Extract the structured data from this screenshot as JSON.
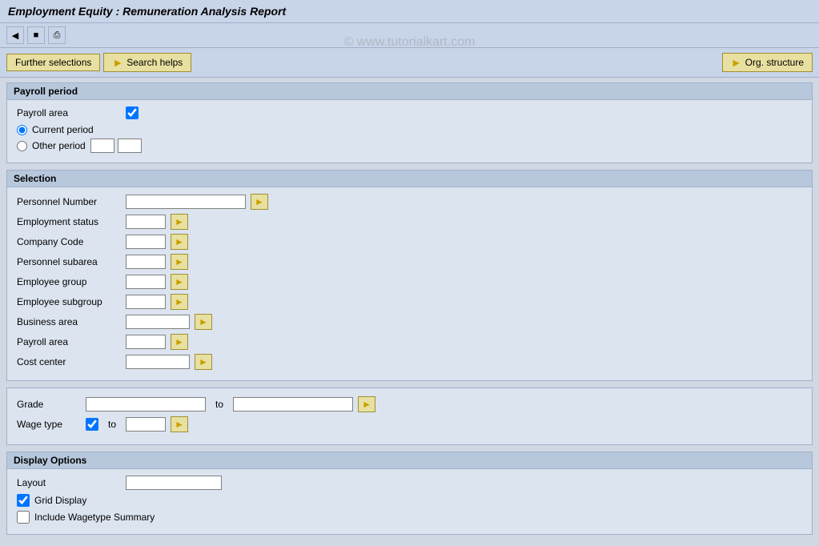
{
  "title": "Employment Equity : Remuneration Analysis Report",
  "watermark": "© www.tutorialkart.com",
  "toolbar": {
    "icons": [
      "back",
      "save",
      "print"
    ]
  },
  "buttons": {
    "further_selections": "Further selections",
    "search_helps": "Search helps",
    "org_structure": "Org. structure"
  },
  "payroll_period": {
    "header": "Payroll period",
    "payroll_area_label": "Payroll area",
    "current_period_label": "Current period",
    "other_period_label": "Other period"
  },
  "selection": {
    "header": "Selection",
    "fields": [
      {
        "label": "Personnel Number",
        "size": "lg"
      },
      {
        "label": "Employment status",
        "size": "sm"
      },
      {
        "label": "Company Code",
        "size": "sm"
      },
      {
        "label": "Personnel subarea",
        "size": "sm"
      },
      {
        "label": "Employee group",
        "size": "sm"
      },
      {
        "label": "Employee subgroup",
        "size": "sm"
      },
      {
        "label": "Business area",
        "size": "md"
      },
      {
        "label": "Payroll area",
        "size": "sm"
      },
      {
        "label": "Cost center",
        "size": "md"
      }
    ]
  },
  "grade_wagetype": {
    "grade_label": "Grade",
    "wagetype_label": "Wage type",
    "to_label": "to"
  },
  "display_options": {
    "header": "Display Options",
    "layout_label": "Layout",
    "grid_display_label": "Grid Display",
    "grid_display_checked": true,
    "include_wagetype_label": "Include Wagetype Summary",
    "include_wagetype_checked": false
  }
}
